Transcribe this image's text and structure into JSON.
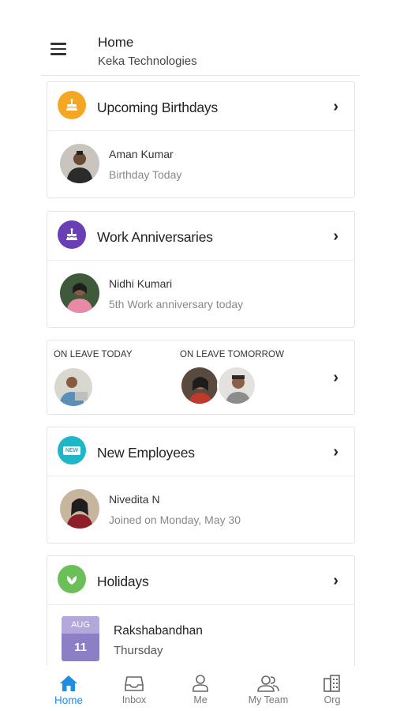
{
  "header": {
    "title": "Home",
    "subtitle": "Keka Technologies"
  },
  "birthdays": {
    "title": "Upcoming Birthdays",
    "icon": "cake-icon",
    "icon_color": "#f5a623",
    "person": {
      "name": "Aman Kumar",
      "detail": "Birthday Today"
    }
  },
  "anniversaries": {
    "title": "Work Anniversaries",
    "icon": "cake-icon",
    "icon_color": "#6a3fb5",
    "person": {
      "name": "Nidhi Kumari",
      "detail": "5th Work anniversary today"
    }
  },
  "leave": {
    "today_label": "ON LEAVE TODAY",
    "tomorrow_label": "ON LEAVE TOMORROW"
  },
  "new_employees": {
    "title": "New Employees",
    "icon_text": "NEW",
    "icon_color": "#1fb6c8",
    "person": {
      "name": "Nivedita N",
      "detail": "Joined on Monday, May 30"
    }
  },
  "holidays": {
    "title": "Holidays",
    "icon": "leaf-icon",
    "icon_color": "#6bbf59",
    "item": {
      "month": "AUG",
      "day": "11",
      "name": "Rakshabandhan",
      "weekday": "Thursday"
    }
  },
  "tabs": [
    {
      "label": "Home",
      "icon": "home-icon",
      "active": true
    },
    {
      "label": "Inbox",
      "icon": "inbox-icon"
    },
    {
      "label": "Me",
      "icon": "person-icon"
    },
    {
      "label": "My Team",
      "icon": "team-icon"
    },
    {
      "label": "Org",
      "icon": "org-icon"
    }
  ],
  "accent_color": "#1f8ee0"
}
